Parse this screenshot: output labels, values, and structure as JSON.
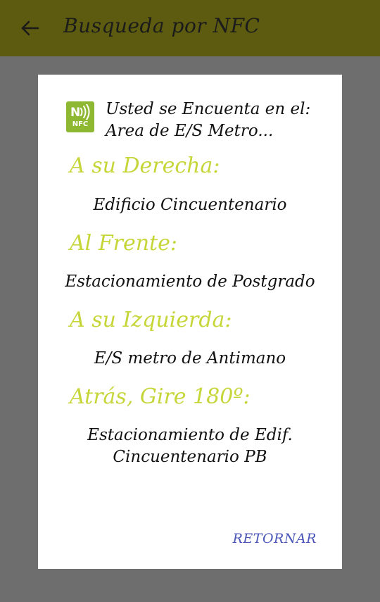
{
  "appbar": {
    "back_icon": "arrow-back-icon",
    "title": "Busqueda por NFC"
  },
  "dialog": {
    "nfc_icon": "nfc-icon",
    "nfc_icon_text": "NFC",
    "location_text": "Usted se Encuenta en el: Area de E/S Metro...",
    "directions": [
      {
        "label": "A su Derecha:",
        "value": "Edificio Cincuentenario"
      },
      {
        "label": "Al Frente:",
        "value": "Estacionamiento de Postgrado"
      },
      {
        "label": "A su Izquierda:",
        "value": "E/S metro de Antimano"
      },
      {
        "label": "Atrás, Gire 180º:",
        "value": "Estacionamiento de Edif. Cincuentenario PB"
      }
    ],
    "return_button": "RETORNAR"
  },
  "colors": {
    "appbar_bg": "#5c5b10",
    "scrim": "#6e6e6e",
    "label_accent": "#c6d639",
    "nfc_badge": "#8fb832",
    "button_text": "#4a57b8"
  }
}
